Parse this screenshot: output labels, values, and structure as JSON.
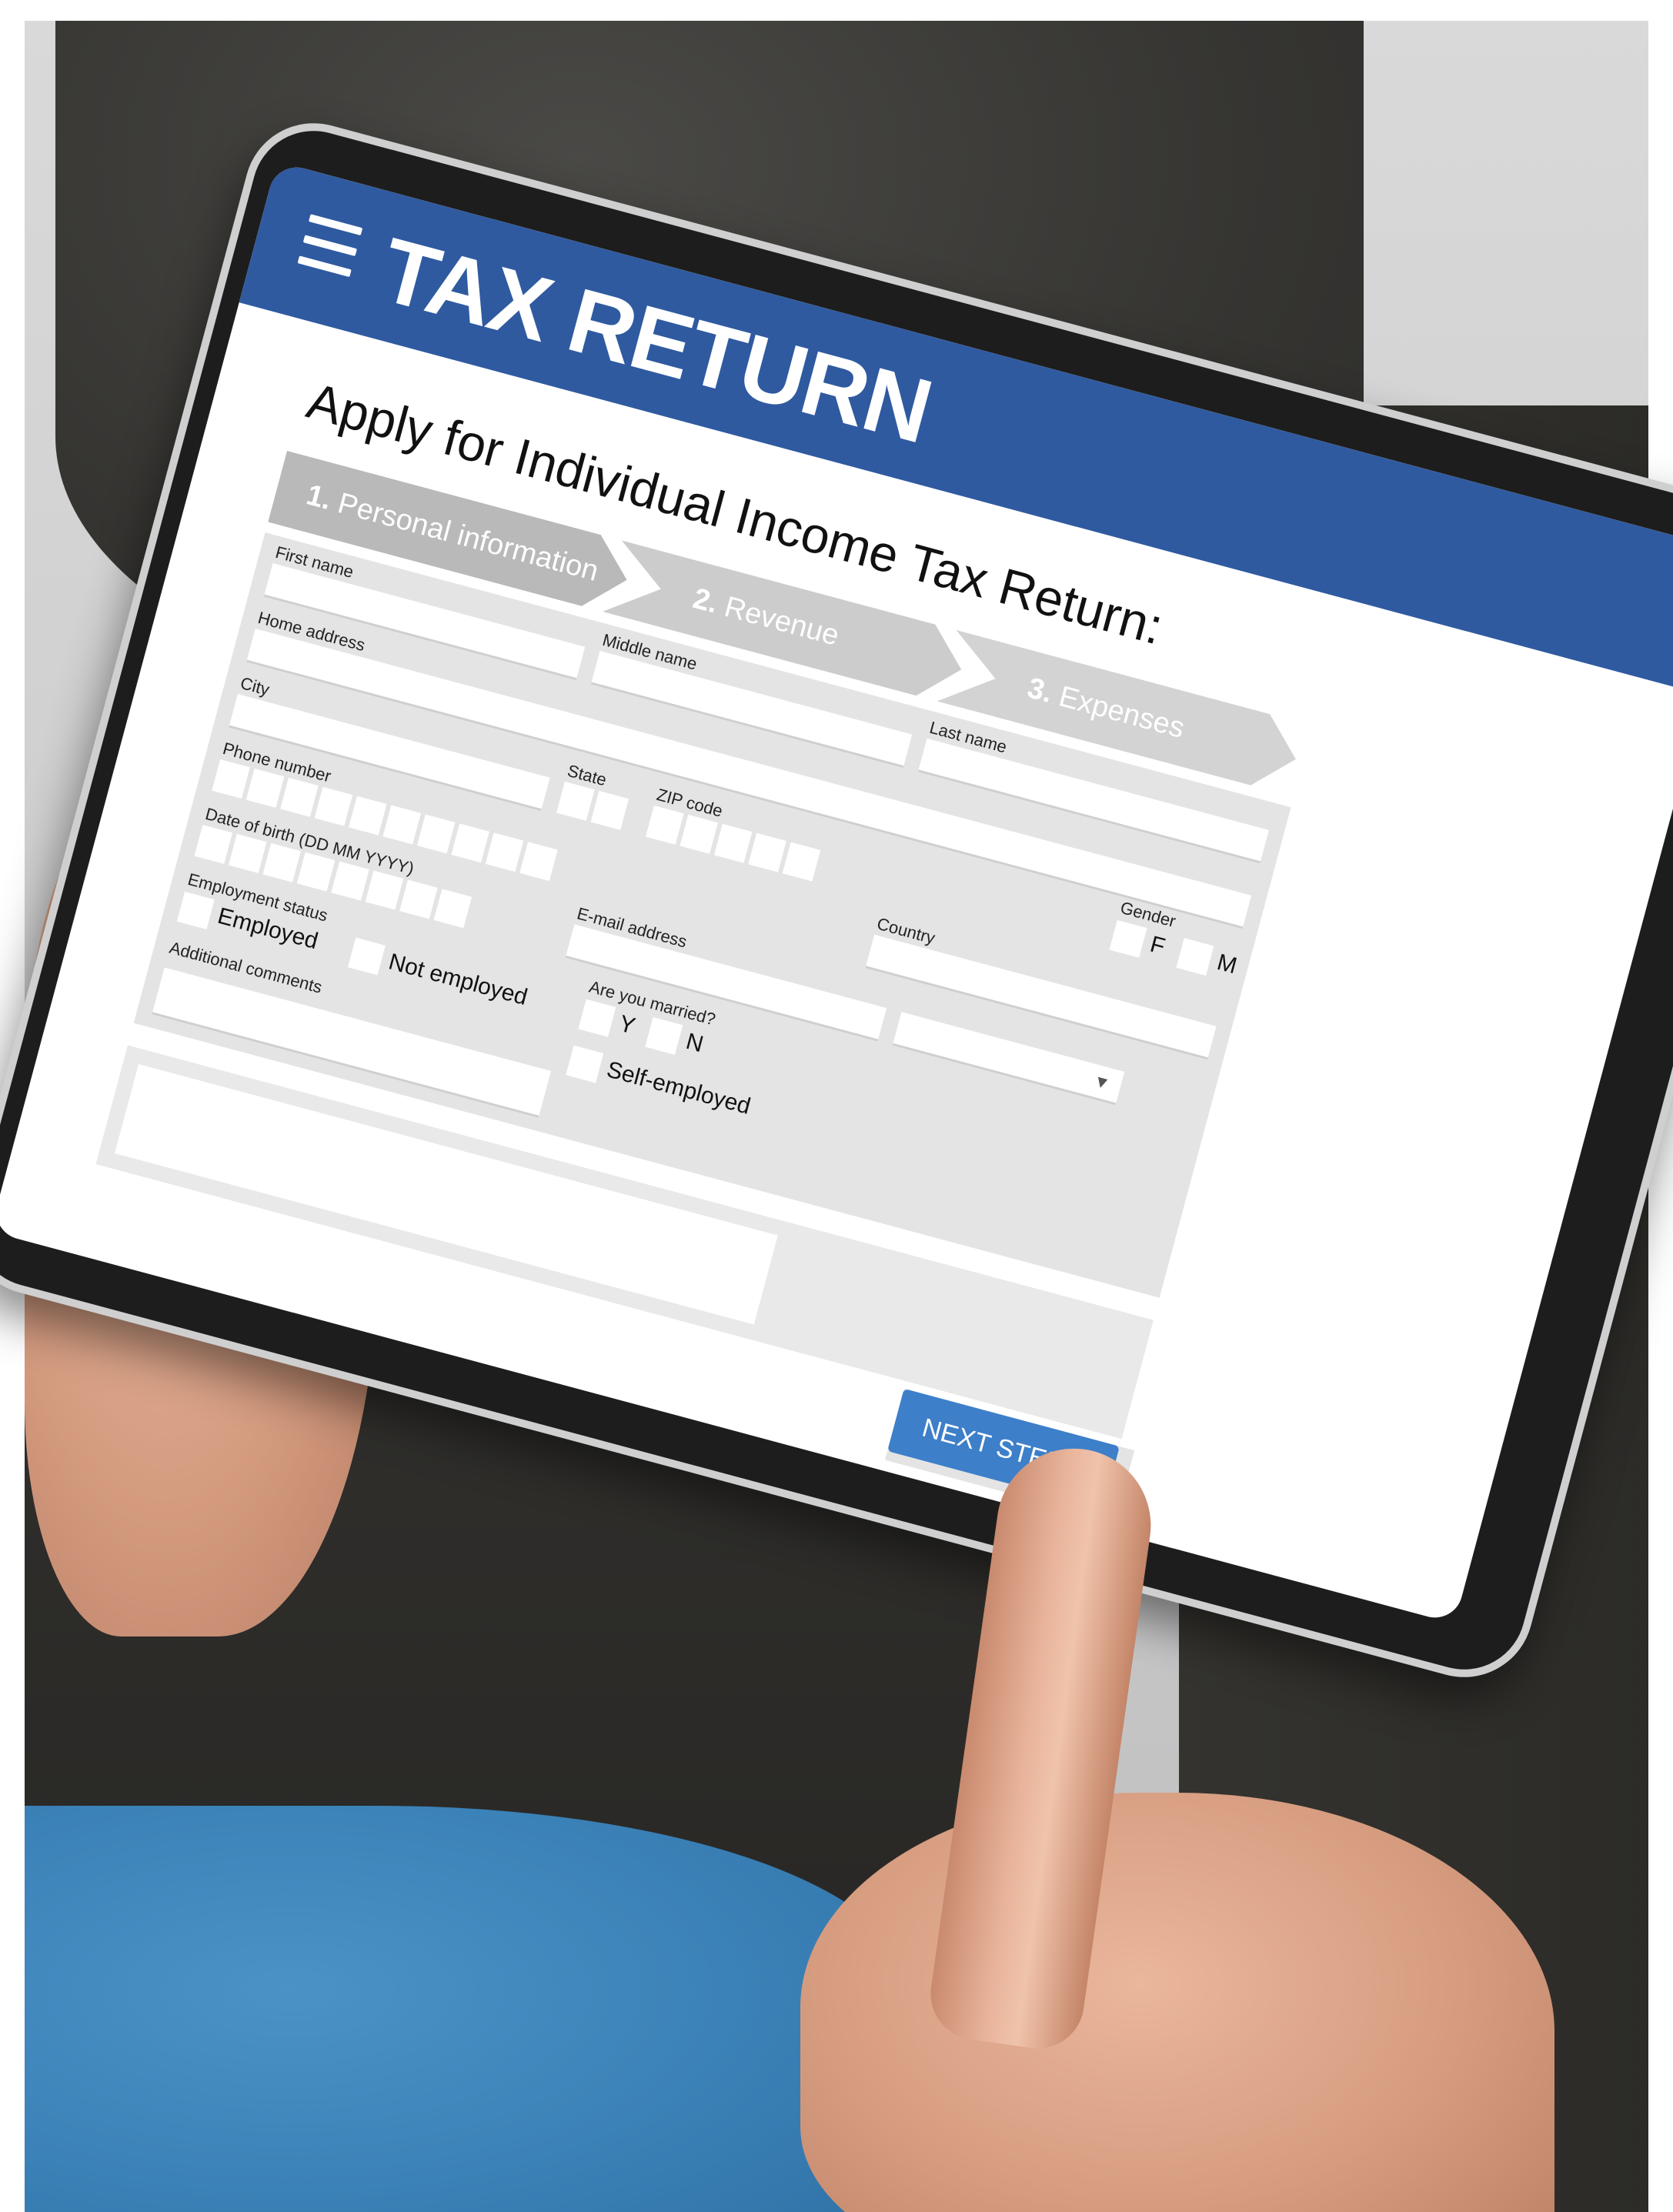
{
  "app": {
    "title": "TAX RETURN"
  },
  "form": {
    "heading": "Apply for Individual Income Tax Return:"
  },
  "steps": [
    {
      "number": "1.",
      "label": "Personal information"
    },
    {
      "number": "2.",
      "label": "Revenue"
    },
    {
      "number": "3.",
      "label": "Expenses"
    }
  ],
  "fields": {
    "first_name": "First name",
    "middle_name": "Middle name",
    "last_name": "Last name",
    "home_address": "Home address",
    "city": "City",
    "state": "State",
    "zip_code": "ZIP code",
    "gender": "Gender",
    "gender_f": "F",
    "gender_m": "M",
    "country": "Country",
    "phone_number": "Phone number",
    "email_address": "E-mail address",
    "date_of_birth": "Date of birth (DD MM YYYY)",
    "are_you_married": "Are you married?",
    "married_y": "Y",
    "married_n": "N",
    "employment_status": "Employment status",
    "employed": "Employed",
    "not_employed": "Not employed",
    "self_employed": "Self-employed",
    "additional_comments": "Additional comments"
  },
  "actions": {
    "next_step": "NEXT STEP >"
  },
  "icons": {
    "menu": "hamburger-menu-icon",
    "dropdown": "chevron-down-icon"
  },
  "colors": {
    "header": "#2f5aa0",
    "button": "#3d7fc9",
    "panel": "#e4e4e4",
    "step_active": "#b9b9b9"
  }
}
